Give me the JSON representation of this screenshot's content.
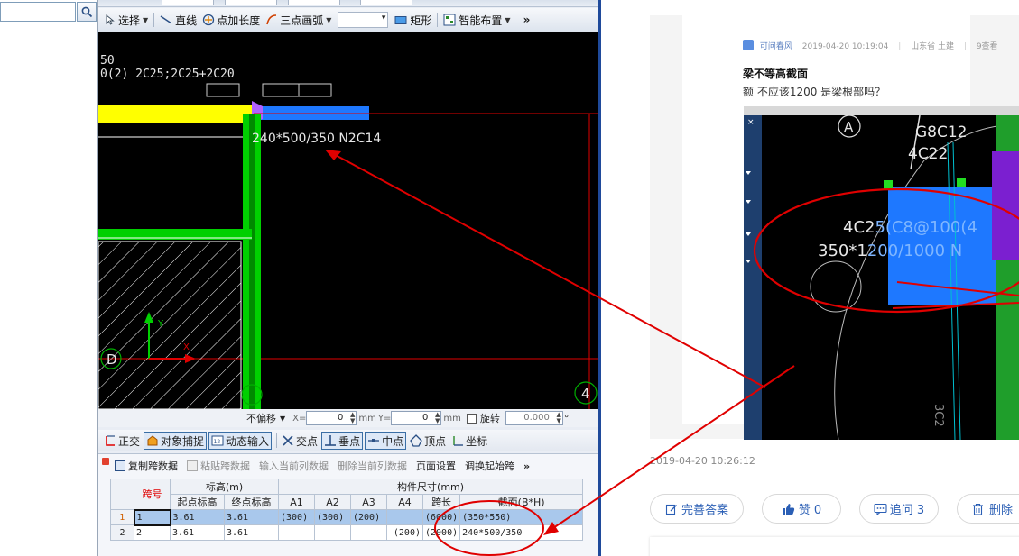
{
  "cad": {
    "toolbar": {
      "select": "选择",
      "line": "直线",
      "point_length": "点加长度",
      "three_point_arc": "三点画弧",
      "rect": "矩形",
      "smart_layout": "智能布置",
      "more": "»"
    },
    "canvas": {
      "text_fragment_1": "50",
      "text_fragment_2": "0(2) 2C25;2C25+2C20",
      "beam_label": "240*500/350 N2C14",
      "axis_d": "D",
      "axis_4": "4",
      "axis_y": "Y",
      "axis_x": "X"
    },
    "status": {
      "offset_mode": "不偏移",
      "x_label": "X=",
      "x_value": "0",
      "mm1": "mm",
      "y_label": "Y=",
      "y_value": "0",
      "mm2": "mm",
      "rotate_label": "旋转",
      "rotate_value": "0.000",
      "degree": "°"
    },
    "snap": {
      "ortho": "正交",
      "object_snap": "对象捕捉",
      "dynamic_input": "动态输入",
      "intersection": "交点",
      "perpendicular": "垂点",
      "midpoint": "中点",
      "vertex": "顶点",
      "coordinate": "坐标"
    },
    "table_toolbar": {
      "copy_span": "复制跨数据",
      "paste_span": "粘贴跨数据",
      "input_col": "输入当前列数据",
      "delete_col": "删除当前列数据",
      "page_setup": "页面设置",
      "swap_start": "调换起始跨",
      "more": "»"
    },
    "table": {
      "span_no": "跨号",
      "elevation": "标高(m)",
      "start_elev": "起点标高",
      "end_elev": "终点标高",
      "dims": "构件尺寸(mm)",
      "a1": "A1",
      "a2": "A2",
      "a3": "A3",
      "a4": "A4",
      "span_len": "跨长",
      "section": "截面(B*H)",
      "rows": [
        {
          "idx": "1",
          "span": "1",
          "start": "3.61",
          "end": "3.61",
          "a1": "(300)",
          "a2": "(300)",
          "a3": "(200)",
          "a4": "",
          "len": "(6000)",
          "section": "(350*550)"
        },
        {
          "idx": "2",
          "span": "2",
          "start": "3.61",
          "end": "3.61",
          "a1": "",
          "a2": "",
          "a3": "",
          "a4": "(200)",
          "len": "(2000)",
          "section": "240*500/350"
        }
      ]
    }
  },
  "qa": {
    "author": "可问春风",
    "datetime": "2019-04-20 10:19:04",
    "location": "山东省 土建",
    "views_fragment": "9查看",
    "title": "梁不等高截面",
    "body": "额 不应该1200 是梁根部吗？",
    "image": {
      "axis_a": "A",
      "t1": "G8C12",
      "t2": "4C22",
      "t3_white": "4C2",
      "t3_blue": "5(C8@100(4",
      "t4_white": "350*1",
      "t4_blue": "200/1000 N"
    },
    "answer_time": "2019-04-20 10:26:12",
    "btn_improve": "完善答案",
    "btn_like": "赞 0",
    "btn_ask": "追问 3",
    "btn_delete": "删除"
  },
  "colors": {
    "annotation_red": "#e00000",
    "cad_green": "#00d000",
    "cad_yellow": "#ffff00",
    "cad_blue": "#1e78ff",
    "link_blue": "#2b5fb5"
  }
}
